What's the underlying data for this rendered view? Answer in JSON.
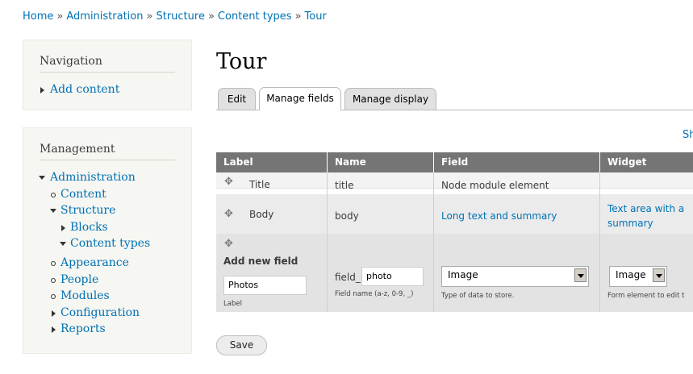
{
  "breadcrumb": [
    "Home",
    "Administration",
    "Structure",
    "Content types",
    "Tour"
  ],
  "breadcrumb_separator": "»",
  "navigation": {
    "title": "Navigation",
    "items": [
      {
        "label": "Add content"
      }
    ]
  },
  "management": {
    "title": "Management",
    "items": {
      "administration": "Administration",
      "content": "Content",
      "structure": "Structure",
      "blocks": "Blocks",
      "content_types": "Content types",
      "appearance": "Appearance",
      "people": "People",
      "modules": "Modules",
      "configuration": "Configuration",
      "reports": "Reports"
    }
  },
  "page": {
    "title": "Tour",
    "tabs": [
      "Edit",
      "Manage fields",
      "Manage display"
    ],
    "active_tab": "Manage fields",
    "show_link": "Sh"
  },
  "table": {
    "headers": [
      "Label",
      "Name",
      "Field",
      "Widget"
    ],
    "rows": [
      {
        "label": "Title",
        "name": "title",
        "field": "Node module element",
        "widget": ""
      },
      {
        "label": "Body",
        "name": "body",
        "field": "Long text and summary",
        "widget": "Text area with a summary"
      }
    ],
    "add_new": {
      "heading": "Add new field",
      "label_value": "Photos",
      "label_caption": "Label",
      "name_prefix": "field_",
      "name_value": "photo",
      "name_caption": "Field name (a-z, 0-9, _)",
      "field_type_value": "Image",
      "field_type_caption": "Type of data to store.",
      "widget_value": "Image",
      "widget_caption": "Form element to edit t"
    }
  },
  "actions": {
    "save": "Save"
  },
  "colors": {
    "link": "#0071b3",
    "header_bg": "#757575",
    "row_odd": "#f3f3f3",
    "row_even": "#e6e6e6"
  }
}
